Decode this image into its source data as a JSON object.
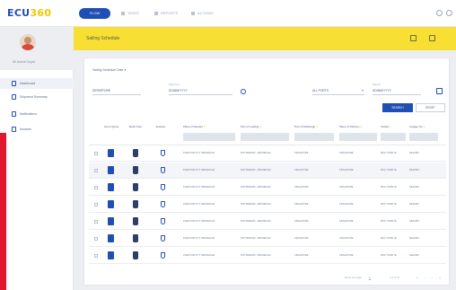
{
  "topbar": {
    "logo_a": "ECU",
    "logo_b": "360",
    "nav": [
      {
        "label": "FLOW",
        "active": true
      },
      {
        "label": "TASKS",
        "active": false
      },
      {
        "label": "REPORTS",
        "active": false
      },
      {
        "label": "ACTIONS",
        "active": false
      }
    ]
  },
  "sidebar": {
    "user_name": "Mr Ashok Gupta",
    "items": [
      {
        "label": "Dashboard",
        "active": true
      },
      {
        "label": "Shipment Summary",
        "active": false
      },
      {
        "label": "Notifications",
        "active": false
      },
      {
        "label": "Invoices",
        "active": false
      }
    ]
  },
  "page": {
    "title": "Sailing Schedule"
  },
  "search": {
    "section_label": "Sailing Schedule Date",
    "origin_value": "DEPARTURE",
    "date_from_label": "Date From",
    "date_from_value": "DD/MM/YYYY",
    "port_label": "",
    "port_value": "ALL PORTS",
    "date_to_label": "Date To",
    "date_to_value": "DD/MM/YYYY",
    "search_button": "SEARCH",
    "reset_button": "RESET"
  },
  "table": {
    "columns": [
      "Get a Quote",
      "Book Now",
      "Enquire",
      "Place of Receipt",
      "Port of Loading",
      "Port of Discharge",
      "Place of Delivery",
      "Vessel",
      "Voyage No"
    ],
    "rows": [
      [
        "PHANTOM CITY ABCDEFGHI",
        "ROTTERDAM - ABCDEFGHI",
        "SINGAPORE",
        "SINGAPORE",
        "MSC TURKIYE",
        "NE12345"
      ],
      [
        "PHANTOM CITY ABCDEFGHI",
        "ROTTERDAM - ABCDEFGHI",
        "SINGAPORE",
        "SINGAPORE",
        "MSC TURKIYE",
        "NE12345"
      ],
      [
        "PHANTOM CITY ABCDEFGHI",
        "ROTTERDAM - ABCDEFGHI",
        "SINGAPORE",
        "SINGAPORE",
        "MSC TURKIYE",
        "NE12345"
      ],
      [
        "PHANTOM CITY ABCDEFGHI",
        "ROTTERDAM - ABCDEFGHI",
        "SINGAPORE",
        "SINGAPORE",
        "MSC TURKIYE",
        "NE12345"
      ],
      [
        "PHANTOM CITY ABCDEFGHI",
        "ROTTERDAM - ABCDEFGHI",
        "SINGAPORE",
        "SINGAPORE",
        "MSC TURKIYE",
        "NE12345"
      ],
      [
        "PHANTOM CITY ABCDEFGHI",
        "ROTTERDAM - ABCDEFGHI",
        "SINGAPORE",
        "SINGAPORE",
        "MSC TURKIYE",
        "NE12345"
      ],
      [
        "PHANTOM CITY ABCDEFGHI",
        "ROTTERDAM - ABCDEFGHI",
        "SINGAPORE",
        "SINGAPORE",
        "MSC TURKIYE",
        "NE12345"
      ]
    ]
  },
  "pager": {
    "rows_per_page_label": "Rows per page",
    "rows_per_page_value": "5",
    "range": "1-5 of 10"
  },
  "colors": {
    "brand_blue": "#1f4fb4",
    "brand_yellow": "#f7e033",
    "accent_red": "#e0182d"
  }
}
